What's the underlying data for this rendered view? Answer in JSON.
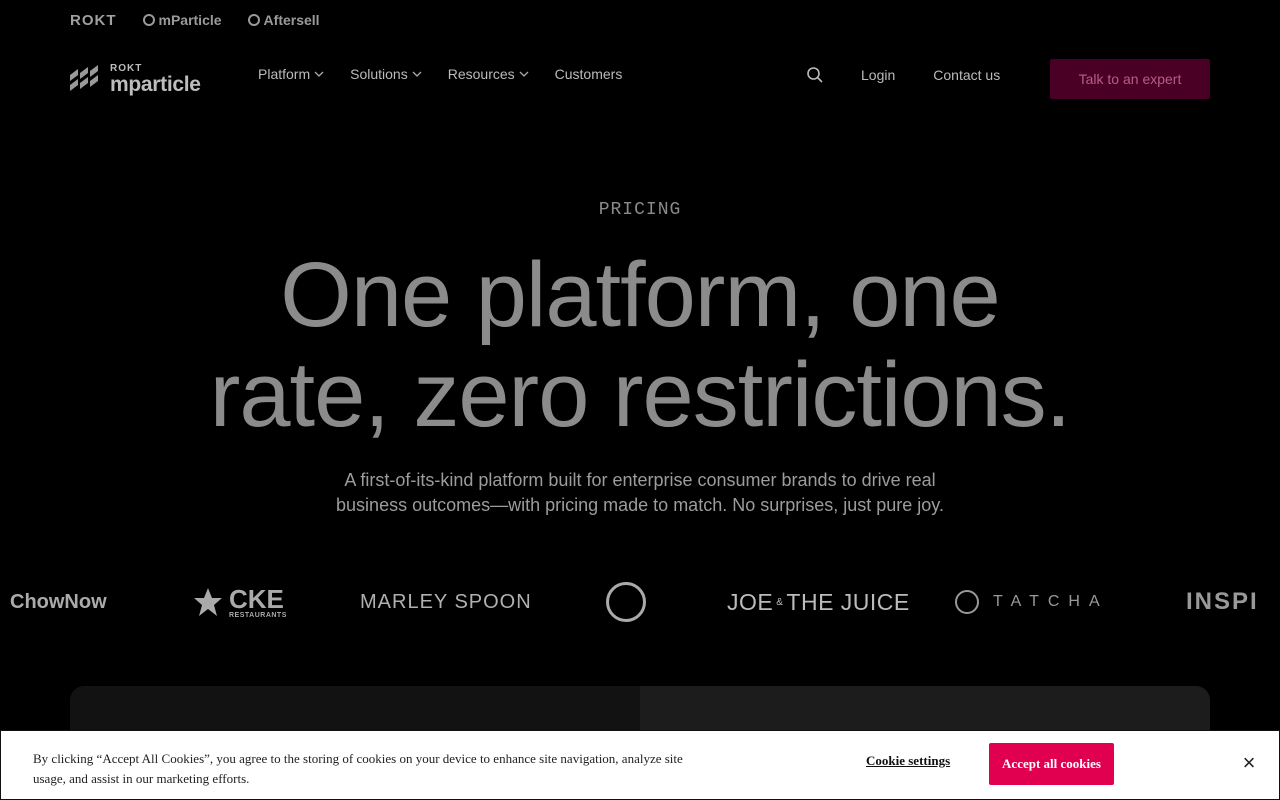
{
  "topbrands": {
    "rokt": "ROKT",
    "mparticle": "mParticle",
    "aftersell": "Aftersell"
  },
  "logo": {
    "top": "ROKT",
    "main": "mparticle"
  },
  "nav": {
    "items": [
      {
        "label": "Platform"
      },
      {
        "label": "Solutions"
      },
      {
        "label": "Resources"
      },
      {
        "label": "Customers"
      }
    ],
    "login": "Login",
    "contact": "Contact us",
    "cta": "Talk to an expert"
  },
  "hero": {
    "eyebrow": "PRICING",
    "headline_line1": "One platform, one",
    "headline_line2": "rate, zero restrictions.",
    "subtext_line1": "A first-of-its-kind platform built for enterprise consumer brands to drive real",
    "subtext_line2": "business outcomes—with pricing made to match. No surprises, just pure joy."
  },
  "logos": {
    "chownow": "ChowNow",
    "cke_main": "CKE",
    "cke_sub": "RESTAURANTS",
    "marley": "MARLEY SPOON",
    "joe_a": "JOE",
    "joe_amp": "&",
    "joe_b": "THE JUICE",
    "tatcha": "TATCHA",
    "inspire": "INSPI"
  },
  "cookie": {
    "text": "By clicking “Accept All Cookies”, you agree to the storing of cookies on your device to enhance site navigation, analyze site usage, and assist in our marketing efforts.",
    "settings": "Cookie settings",
    "accept": "Accept all cookies",
    "close": "×"
  },
  "colors": {
    "cta_bg": "#4a0024",
    "accept_bg": "#e0004f",
    "background": "#000000"
  }
}
